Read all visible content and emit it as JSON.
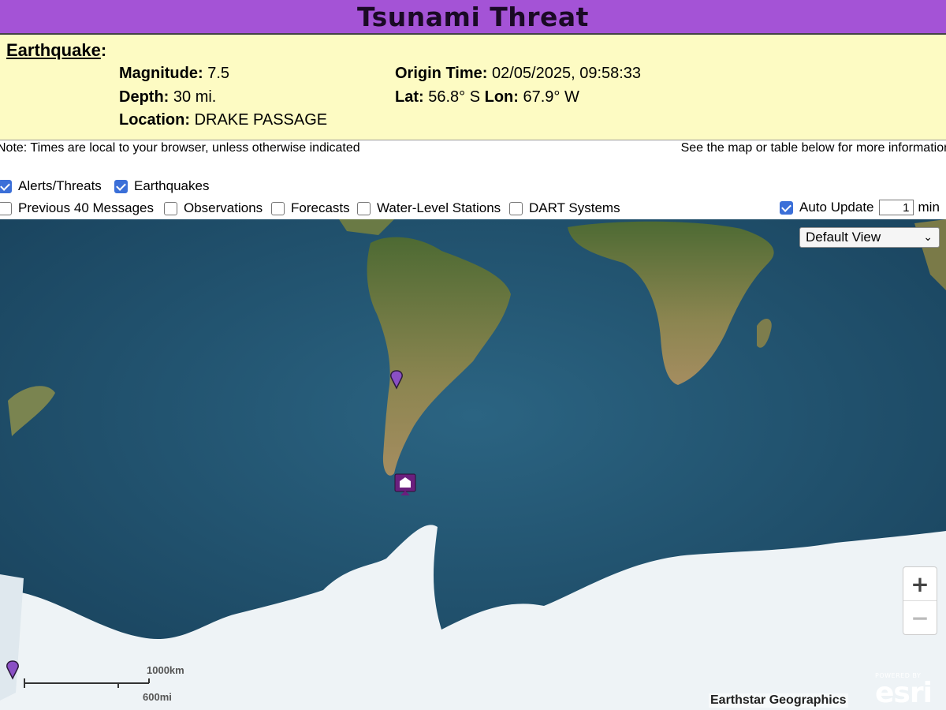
{
  "header": {
    "title": "Tsunami Threat"
  },
  "earthquake": {
    "heading": "Earthquake",
    "heading_suffix": ":",
    "magnitude_label": "Magnitude:",
    "magnitude": "7.5",
    "depth_label": "Depth:",
    "depth": "30 mi.",
    "location_label": "Location:",
    "location": "DRAKE PASSAGE",
    "origin_label": "Origin Time:",
    "origin_time": "02/05/2025, 09:58:33",
    "lat_label": "Lat:",
    "lat": "56.8° S",
    "lon_label": "Lon:",
    "lon": "67.9° W"
  },
  "notes": {
    "left": "Note: Times are local to your browser, unless otherwise indicated",
    "right": "See the map or table below for more information"
  },
  "layers": {
    "alerts": {
      "label": "Alerts/Threats",
      "checked": true
    },
    "earthquakes": {
      "label": "Earthquakes",
      "checked": true
    },
    "previous": {
      "label": "Previous 40 Messages",
      "checked": false
    },
    "observations": {
      "label": "Observations",
      "checked": false
    },
    "forecasts": {
      "label": "Forecasts",
      "checked": false
    },
    "water_level": {
      "label": "Water-Level Stations",
      "checked": false
    },
    "dart": {
      "label": "DART Systems",
      "checked": false
    }
  },
  "auto_update": {
    "label": "Auto Update",
    "checked": true,
    "minutes": "1",
    "unit": "min"
  },
  "map": {
    "view_select": "Default View",
    "zoom_in": "+",
    "zoom_out": "−",
    "scale_km": "1000km",
    "scale_mi": "600mi",
    "attribution": "Earthstar Geographics",
    "esri_powered": "POWERED BY",
    "esri_logo": "esri",
    "colors": {
      "ocean": "#1f4e6b",
      "land": "#7a7a48",
      "ice": "#eef3f6",
      "pin": "#8a4fc4",
      "alert_marker": "#6b1f7e"
    }
  }
}
